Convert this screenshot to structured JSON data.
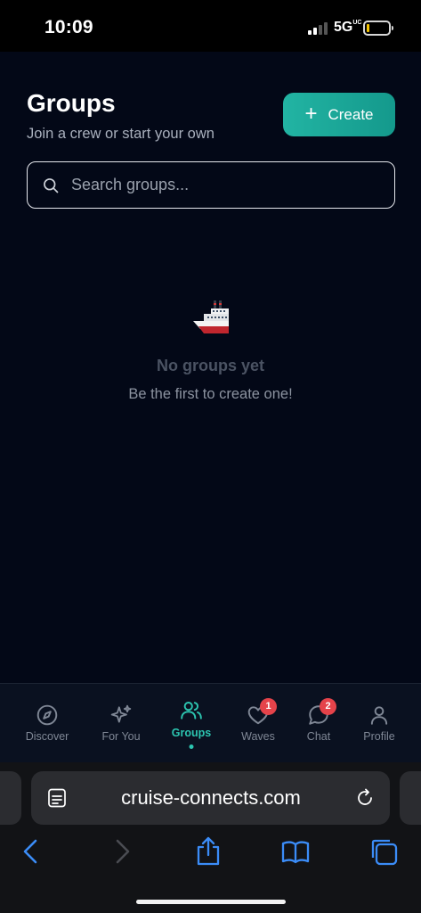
{
  "status_bar": {
    "time": "10:09",
    "network": "5G",
    "network_superscript": "UC"
  },
  "header": {
    "title": "Groups",
    "subtitle": "Join a crew or start your own"
  },
  "create_button": {
    "label": "Create",
    "icon": "plus-icon"
  },
  "search": {
    "placeholder": "Search groups...",
    "value": "",
    "icon": "search-icon"
  },
  "empty_state": {
    "icon": "ship-icon",
    "title": "No groups yet",
    "subtitle": "Be the first to create one!"
  },
  "tabs": [
    {
      "label": "Discover",
      "icon": "compass-icon",
      "active": false,
      "badge": ""
    },
    {
      "label": "For You",
      "icon": "sparkles-icon",
      "active": false,
      "badge": ""
    },
    {
      "label": "Groups",
      "icon": "users-icon",
      "active": true,
      "badge": ""
    },
    {
      "label": "Waves",
      "icon": "heart-icon",
      "active": false,
      "badge": "1"
    },
    {
      "label": "Chat",
      "icon": "chat-bubble-icon",
      "active": false,
      "badge": "2"
    },
    {
      "label": "Profile",
      "icon": "person-icon",
      "active": false,
      "badge": ""
    }
  ],
  "browser": {
    "url": "cruise-connects.com",
    "toolbar": [
      "back-icon",
      "forward-icon",
      "share-icon",
      "bookmarks-icon",
      "tabs-icon"
    ]
  },
  "colors": {
    "accent": "#22b4a3",
    "background": "#030817",
    "badge": "#e5434a",
    "browser_icon": "#3b8cf7"
  }
}
